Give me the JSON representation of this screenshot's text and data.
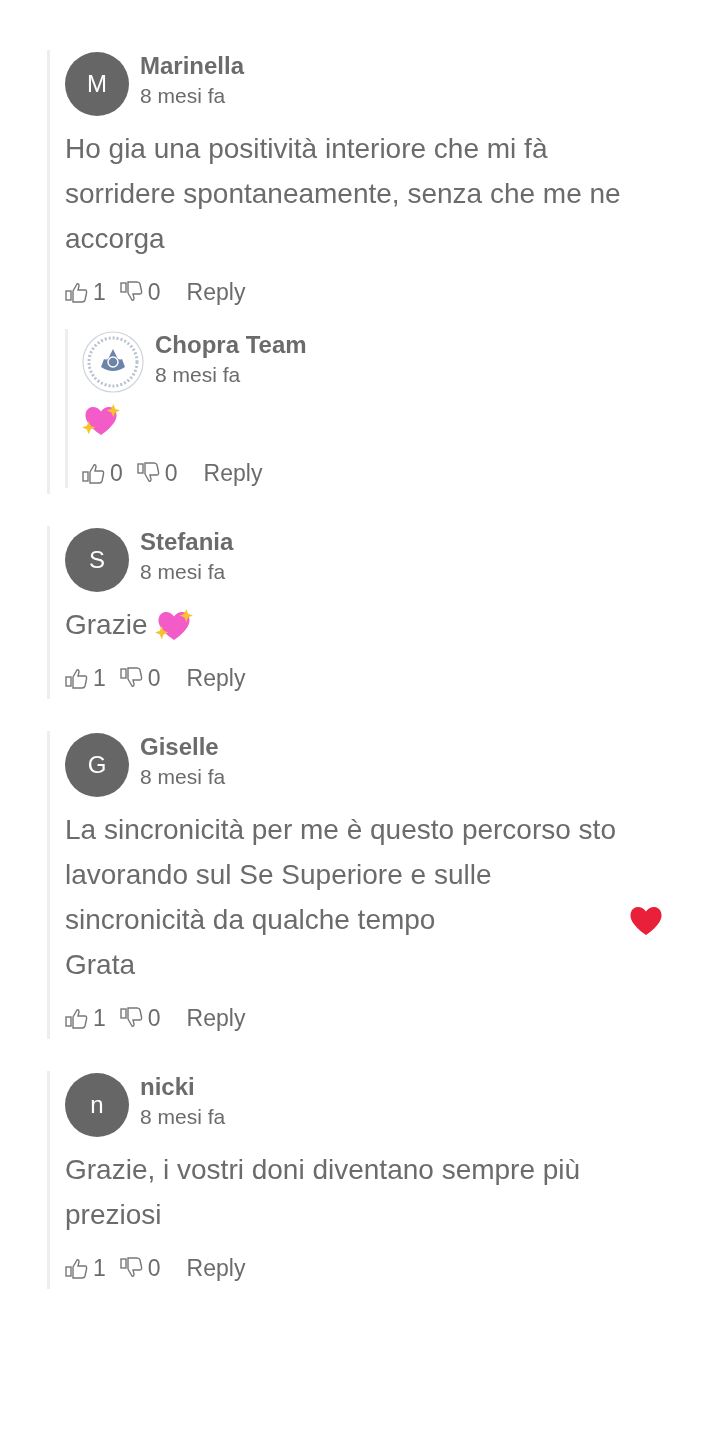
{
  "comments": [
    {
      "avatar": {
        "kind": "letter",
        "letter": "M"
      },
      "name": "Marinella",
      "time": "8 mesi fa",
      "body": [
        [
          {
            "kind": "text",
            "text": "Ho gia una positività interiore che mi fà sorridere spontaneamente, senza che me ne accorga"
          }
        ]
      ],
      "likes": "1",
      "dislikes": "0",
      "reply_label": "Reply",
      "replies": [
        {
          "avatar": {
            "kind": "logo"
          },
          "name": "Chopra Team",
          "time": "8 mesi fa",
          "body": [
            [
              {
                "kind": "sparkling_heart"
              }
            ]
          ],
          "likes": "0",
          "dislikes": "0",
          "reply_label": "Reply"
        }
      ]
    },
    {
      "avatar": {
        "kind": "letter",
        "letter": "S"
      },
      "name": "Stefania",
      "time": "8 mesi fa",
      "body": [
        [
          {
            "kind": "text",
            "text": "Grazie"
          },
          {
            "kind": "sparkling_heart"
          }
        ]
      ],
      "likes": "1",
      "dislikes": "0",
      "reply_label": "Reply"
    },
    {
      "avatar": {
        "kind": "letter",
        "letter": "G"
      },
      "name": "Giselle",
      "time": "8 mesi fa",
      "body": [
        [
          {
            "kind": "text",
            "text": "La sincronicità per me è questo percorso sto lavorando sul Se Superiore e sulle sincronicità da qualche tempo"
          },
          {
            "kind": "red_heart"
          }
        ],
        [
          {
            "kind": "text",
            "text": "Grata"
          }
        ]
      ],
      "likes": "1",
      "dislikes": "0",
      "reply_label": "Reply"
    },
    {
      "avatar": {
        "kind": "letter",
        "letter": "n"
      },
      "name": "nicki",
      "time": "8 mesi fa",
      "body": [
        [
          {
            "kind": "text",
            "text": "Grazie, i vostri doni diventano sempre più preziosi"
          }
        ]
      ],
      "likes": "1",
      "dislikes": "0",
      "reply_label": "Reply"
    }
  ]
}
